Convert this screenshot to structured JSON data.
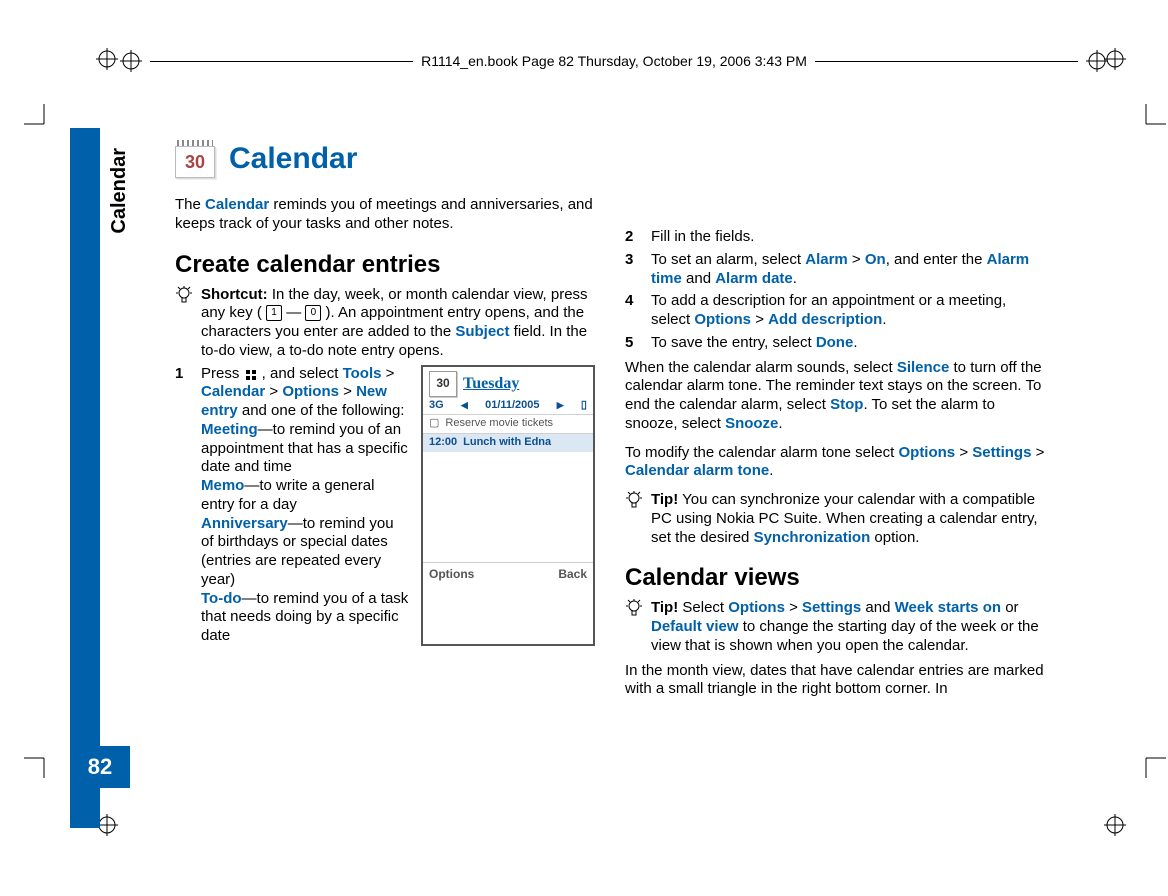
{
  "header_left": "R1114_en.book  Page 82  Thursday, October 19, 2006  3:43 PM",
  "side_tab": "Calendar",
  "page_number": "82",
  "title": "Calendar",
  "cal_icon_num": "30",
  "intro_pre": "The ",
  "intro_link": "Calendar",
  "intro_post": " reminds you of meetings and anniversaries, and keeps track of your tasks and other notes.",
  "h2_create": "Create calendar entries",
  "shortcut_bold": "Shortcut:",
  "shortcut_1": " In the day, week, or month calendar view, press any key ( ",
  "shortcut_dash": " — ",
  "shortcut_2": " ). An appointment entry opens, and the characters you enter are added to the ",
  "shortcut_subject": "Subject",
  "shortcut_3": " field. In the to-do view, a to-do note entry opens.",
  "key1": "1",
  "key0": "0",
  "step1_n": "1",
  "step1_a": "Press ",
  "step1_b": " , and select ",
  "tools": "Tools",
  "gt": " > ",
  "calendar": "Calendar",
  "options": "Options",
  "new_entry": "New entry",
  "step1_c": " and one of the following:",
  "meeting": "Meeting",
  "meeting_t": "—to remind you of an appointment that has a specific date and time",
  "memo": "Memo",
  "memo_t": "—to write a general entry for a day",
  "anniv": "Anniversary",
  "anniv_t": "—to remind you of birthdays or special dates (entries are repeated every year)",
  "todo": "To-do",
  "todo_t": "—to remind you of a task that needs doing by a specific date",
  "phone": {
    "day": "Tuesday",
    "sig": "3G",
    "date": "01/11/2005",
    "row1": "Reserve movie tickets",
    "row2_time": "12:00",
    "row2_text": "Lunch with Edna",
    "sk_left": "Options",
    "sk_right": "Back",
    "mini_num": "30"
  },
  "step2_n": "2",
  "step2": "Fill in the fields.",
  "step3_n": "3",
  "step3_a": "To set an alarm, select ",
  "alarm": "Alarm",
  "on": "On",
  "step3_b": ", and enter the ",
  "alarm_time": "Alarm time",
  "and": " and ",
  "alarm_date": "Alarm date",
  "step3_c": ".",
  "step4_n": "4",
  "step4_a": "To add a description for an appointment or a meeting, select ",
  "add_desc": "Add description",
  "step4_b": ".",
  "step5_n": "5",
  "step5_a": "To save the entry, select ",
  "done": "Done",
  "step5_b": ".",
  "alarm_para_a": "When the calendar alarm sounds, select ",
  "silence": "Silence",
  "alarm_para_b": " to turn off the calendar alarm tone. The reminder text stays on the screen. To end the calendar alarm, select ",
  "stop": "Stop",
  "alarm_para_c": ". To set the alarm to snooze, select ",
  "snooze": "Snooze",
  "alarm_para_d": ".",
  "modify_a": "To modify the calendar alarm tone select ",
  "settings": "Settings",
  "cal_alarm_tone": "Calendar alarm tone",
  "modify_b": ".",
  "tip2_bold": "Tip!",
  "tip2_a": " You can synchronize your calendar with a compatible PC using Nokia PC Suite. When creating a calendar entry, set the desired ",
  "sync": "Synchronization",
  "tip2_b": " option.",
  "h2_views": "Calendar views",
  "tip3_bold": "Tip!",
  "tip3_a": " Select ",
  "tip3_b": " and ",
  "week_starts": "Week starts on",
  "tip3_c": " or ",
  "default_view": "Default view",
  "tip3_d": " to change the starting day of the week or the view that is shown when you open the calendar.",
  "month_para": "In the month view, dates that have calendar entries are marked with a small triangle in the right bottom corner. In"
}
